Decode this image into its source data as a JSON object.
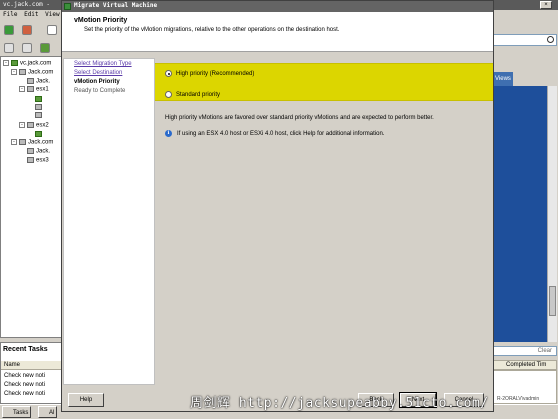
{
  "background": {
    "window_title": "vc.jack.com - ",
    "menu": [
      "File",
      "Edit",
      "View"
    ],
    "tree": {
      "root": "vc.jack.com",
      "nodes": [
        "Jack.com",
        "Jack.",
        "esx1",
        "",
        "",
        "",
        "esx2",
        "",
        "Jack.com",
        "Jack.",
        "esx3"
      ]
    },
    "views_tab": "Views",
    "clear_label": "Clear",
    "recent_tasks": {
      "title": "Recent Tasks",
      "column_name": "Name",
      "column_completed": "Completed Tim",
      "rows": [
        "Check new noti",
        "Check new noti",
        "Check new noti"
      ]
    },
    "taskbar": {
      "tasks_label": "Tasks",
      "alarms_label": "Al"
    },
    "right_footer": "R-2ORALV\\vadmin"
  },
  "dialog": {
    "title": "Migrate Virtual Machine",
    "heading": "vMotion Priority",
    "subheading": "Set the priority of the vMotion migrations, relative to the other operations on the destination host.",
    "steps": [
      {
        "label": "Select Migration Type",
        "state": "link"
      },
      {
        "label": "Select Destination",
        "state": "link"
      },
      {
        "label": "vMotion Priority",
        "state": "current"
      },
      {
        "label": "Ready to Complete",
        "state": "future"
      }
    ],
    "options": [
      {
        "label": "High priority (Recommended)",
        "checked": true
      },
      {
        "label": "Standard priority",
        "checked": false
      }
    ],
    "description": "High priority vMotions are favored over standard priority vMotions and are expected to perform better.",
    "info_text": "If using an ESX 4.0 host or ESXi 4.0 host, click Help for additional information.",
    "buttons": {
      "help": "Help",
      "back": "Back",
      "next": "Next",
      "cancel": "Cancel"
    }
  },
  "watermark": "周剑辉 http://jacksupeabby.51cto.com/",
  "colors": {
    "panel_highlight": "#dcd600",
    "link": "#5a3aa8",
    "blue_panel": "#1e4f9b"
  }
}
